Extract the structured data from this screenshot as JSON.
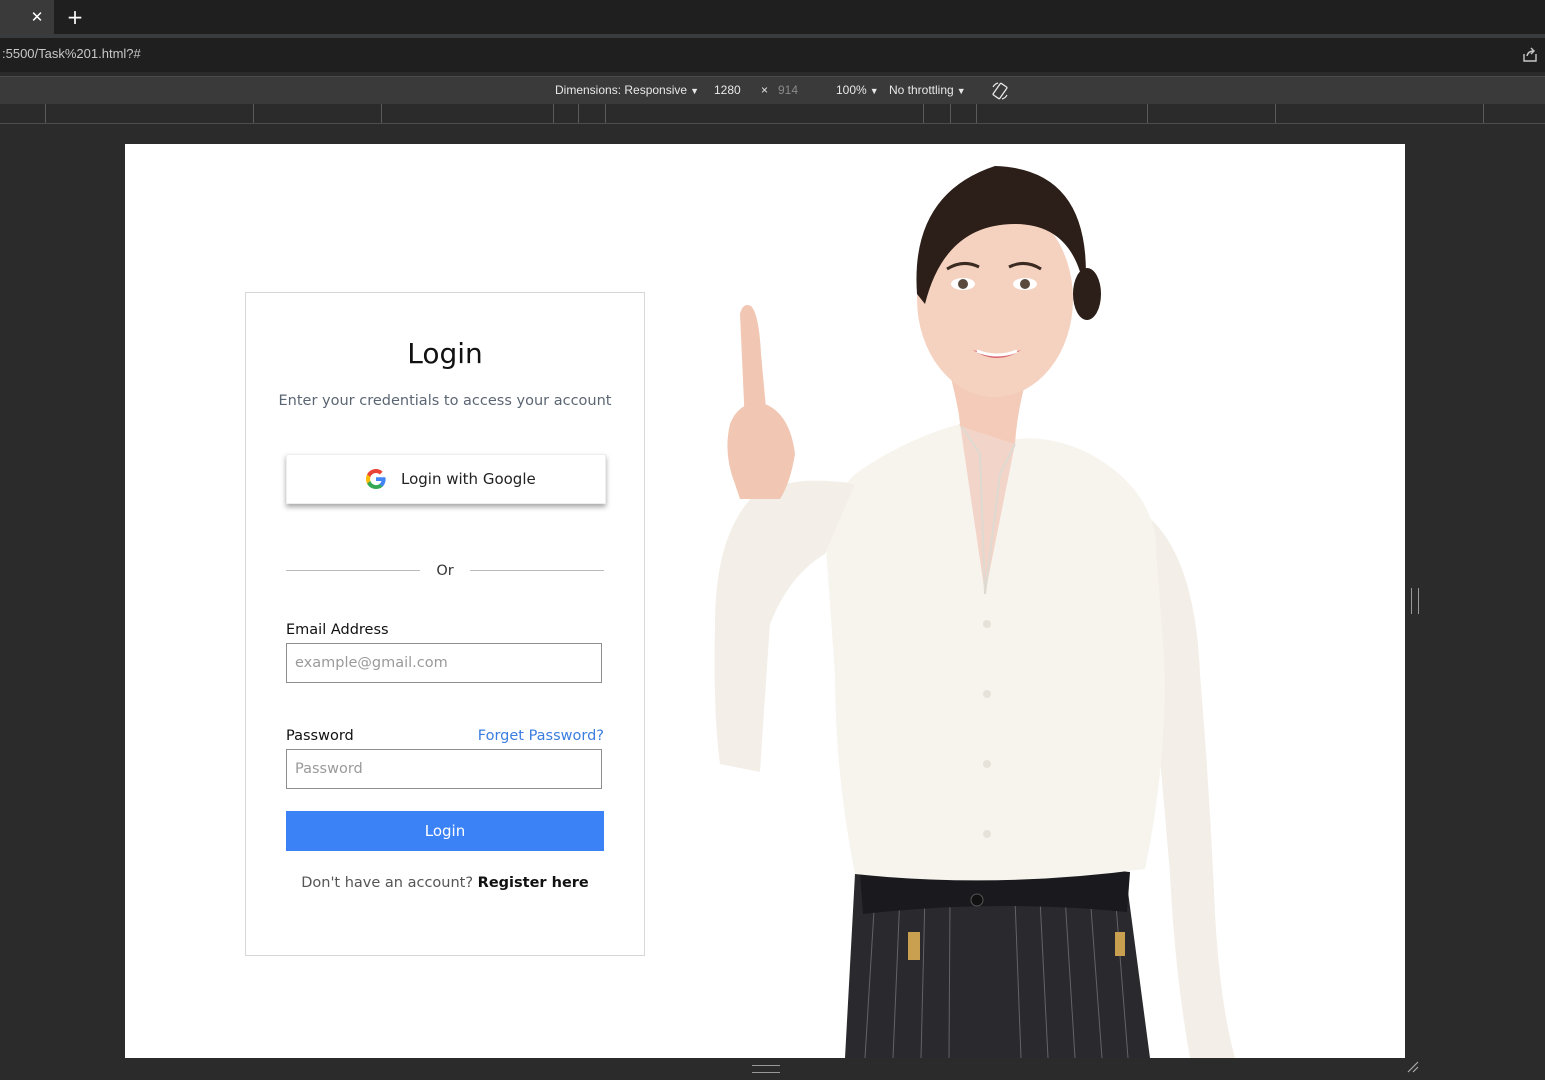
{
  "browser": {
    "tab_close_glyph": "✕",
    "new_tab_glyph": "+",
    "url": ":5500/Task%201.html?#"
  },
  "device_toolbar": {
    "dimensions_label": "Dimensions: Responsive",
    "width": "1280",
    "times": "×",
    "height": "914",
    "zoom": "100%",
    "throttling": "No throttling"
  },
  "login": {
    "title": "Login",
    "subtitle": "Enter your credentials to access your account",
    "google_button": "Login with Google",
    "divider": "Or",
    "email_label": "Email Address",
    "email_placeholder": "example@gmail.com",
    "password_label": "Password",
    "forgot_link": "Forget Password?",
    "password_placeholder": "Password",
    "login_button": "Login",
    "register_prompt": "Don't have an account?",
    "register_link": "Register here"
  },
  "colors": {
    "primary": "#3b82f6",
    "link": "#3b7de0",
    "chrome_bg": "#1f1f1f",
    "viewport_bg": "#ffffff"
  },
  "icons": [
    "close-icon",
    "plus-icon",
    "share-icon",
    "rotate-icon",
    "google-logo-icon",
    "dropdown-caret-icon"
  ]
}
